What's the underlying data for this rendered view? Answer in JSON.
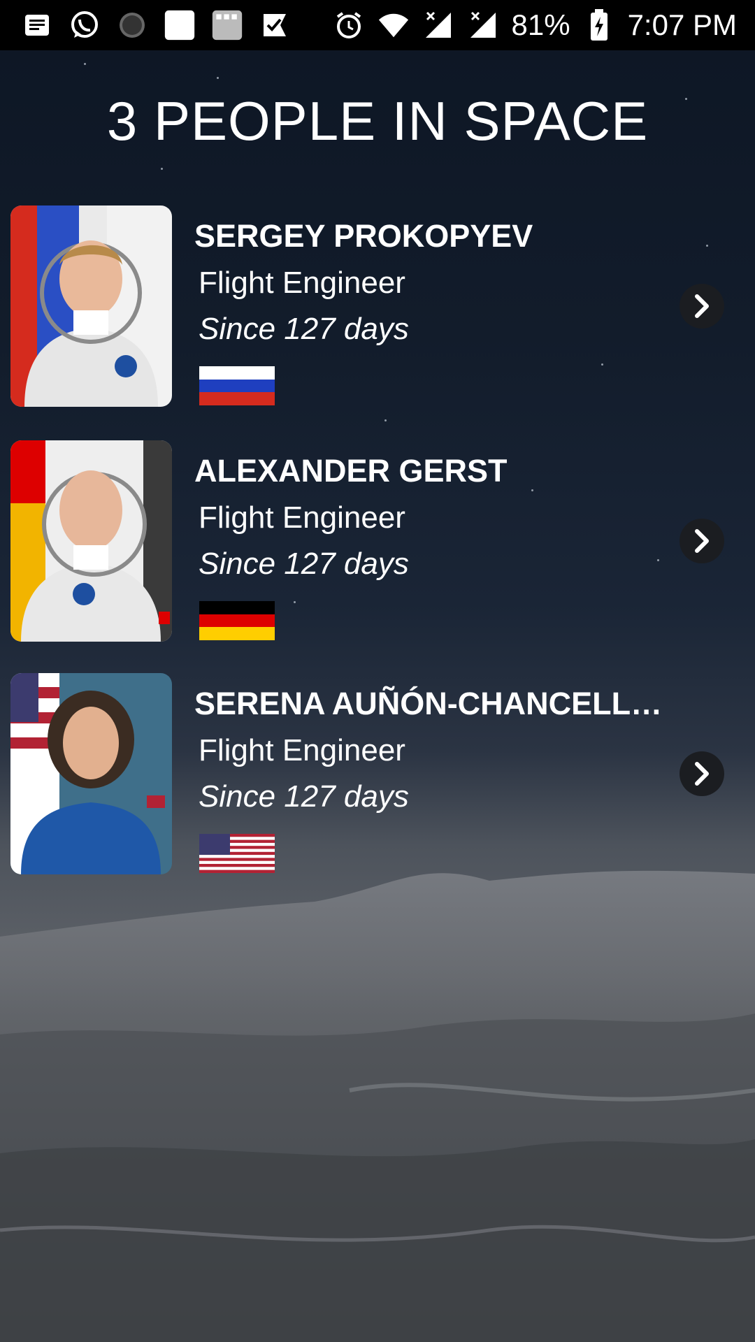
{
  "status_bar": {
    "left_icons": [
      "notes-icon",
      "whatsapp-icon",
      "loading-circle-icon",
      "blank-app-icon",
      "gallery-app-icon",
      "check-flag-icon"
    ],
    "right_icons": [
      "alarm-icon",
      "wifi-icon",
      "signal-x-icon",
      "signal-x-icon-2",
      "battery-charging-icon"
    ],
    "battery": "81%",
    "time": "7:07 PM"
  },
  "page": {
    "title": "3 PEOPLE IN SPACE"
  },
  "people": [
    {
      "name": "SERGEY PROKOPYEV",
      "role": "Flight Engineer",
      "since": "Since 127 days",
      "country_flag": "russia-flag",
      "flag_colors": [
        "#ffffff",
        "#1f3fbf",
        "#d52b1e"
      ]
    },
    {
      "name": "ALEXANDER GERST",
      "role": "Flight Engineer",
      "since": "Since 127 days",
      "country_flag": "germany-flag",
      "flag_colors": [
        "#000000",
        "#dd0000",
        "#ffce00"
      ]
    },
    {
      "name": "SERENA AUÑÓN-CHANCELL…",
      "role": "Flight Engineer",
      "since": "Since 127 days",
      "country_flag": "usa-flag",
      "flag_colors": [
        "#b22234",
        "#ffffff",
        "#3c3b6e"
      ]
    }
  ]
}
